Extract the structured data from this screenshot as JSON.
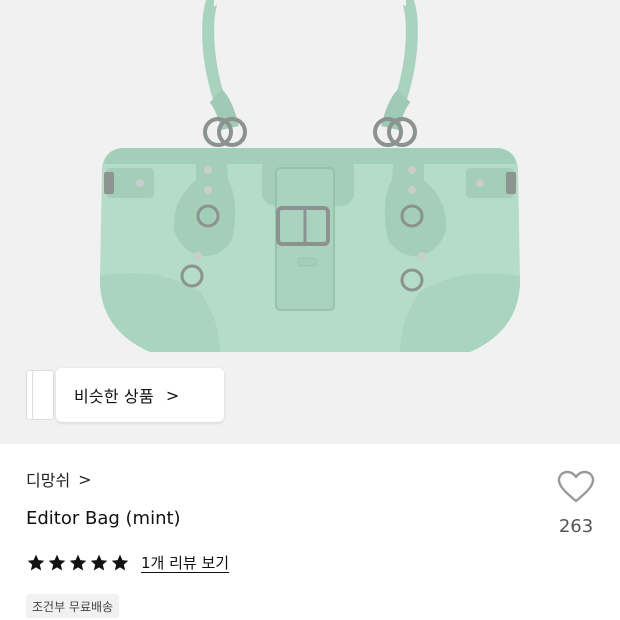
{
  "product_image": {
    "alt": "Editor Bag (mint)",
    "bag_color": "#b4dcc8",
    "background_color": "#f1f1f1"
  },
  "similar": {
    "label": "비슷한 상품",
    "chevron": ">"
  },
  "brand": {
    "name": "디망쉬",
    "chevron": ">"
  },
  "product": {
    "name": "Editor Bag (mint)"
  },
  "rating": {
    "stars": 5,
    "max_stars": 5,
    "review_link": "1개 리뷰 보기"
  },
  "badge": {
    "label": "조건부 무료배송"
  },
  "like": {
    "icon": "heart-outline-icon",
    "count": "263"
  }
}
